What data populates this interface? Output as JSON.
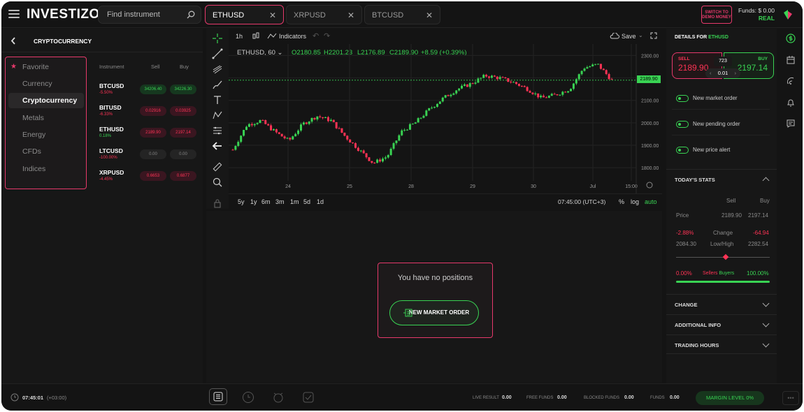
{
  "header": {
    "logo_text": "INVESTIZO",
    "search_placeholder": "Find instrument",
    "tabs": [
      {
        "label": "ETHUSD",
        "active": true
      },
      {
        "label": "XRPUSD",
        "active": false
      },
      {
        "label": "BTCUSD",
        "active": false
      }
    ],
    "switch_label_1": "SWITCH TO",
    "switch_label_2": "DEMO MONEY",
    "funds_label": "Funds: $ 0.00",
    "account_type": "REAL"
  },
  "sidebar": {
    "title": "CRYPTOCURRENCY",
    "categories": [
      "Favorite",
      "Currency",
      "Cryptocurrency",
      "Metals",
      "Energy",
      "CFDs",
      "Indices"
    ],
    "selected": "Cryptocurrency",
    "columns": {
      "instrument": "Instrument",
      "sell": "Sell",
      "buy": "Buy"
    },
    "instruments": [
      {
        "name": "BTCUSD",
        "change": "-5.50%",
        "sell": "34206.40",
        "buy": "34226.30",
        "trend": "up"
      },
      {
        "name": "BITUSD",
        "change": "-6.33%",
        "sell": "0.02916",
        "buy": "0.03925",
        "trend": "down"
      },
      {
        "name": "ETHUSD",
        "change": "0.18%",
        "sell": "2189.90",
        "buy": "2197.14",
        "trend": "down"
      },
      {
        "name": "LTCUSD",
        "change": "-100.00%",
        "sell": "0.00",
        "buy": "0.00",
        "trend": "none"
      },
      {
        "name": "XRPUSD",
        "change": "-4.45%",
        "sell": "0.6653",
        "buy": "0.6877",
        "trend": "down"
      }
    ]
  },
  "chart": {
    "interval": "1h",
    "indicators_label": "Indicators",
    "save_label": "Save",
    "symbol": "ETHUSD, 60",
    "ohlc": {
      "o": "O2180.85",
      "h": "H2201.23",
      "l": "L2176.89",
      "c": "C2189.90",
      "chg": "+8.59 (+0.39%)"
    },
    "price_tag": "2189.90",
    "y_ticks": [
      "2300.00",
      "2200.00",
      "2100.00",
      "2000.00",
      "1900.00",
      "1800.00"
    ],
    "x_ticks": [
      "24",
      "25",
      "28",
      "29",
      "30",
      "Jul",
      "15:00"
    ],
    "ranges": [
      "5y",
      "1y",
      "6m",
      "3m",
      "1m",
      "5d",
      "1d"
    ],
    "time": "07:45:00 (UTC+3)",
    "scale_opts": [
      "%",
      "log",
      "auto"
    ]
  },
  "chart_data": {
    "type": "line",
    "title": "ETHUSD, 60",
    "xlabel": "",
    "ylabel": "",
    "ylim": [
      1760,
      2320
    ],
    "x": [
      "24",
      "25",
      "28",
      "29",
      "30",
      "Jul"
    ],
    "series": [
      {
        "values": [
          1880,
          1990,
          2010,
          1960,
          1920,
          1995,
          2030,
          2010,
          1940,
          1880,
          1820,
          1850,
          1960,
          2000,
          2060,
          2110,
          2150,
          2175,
          2210,
          2200,
          2180,
          2150,
          2110,
          2125,
          2150,
          2245,
          2260,
          2190
        ]
      }
    ]
  },
  "positions": {
    "empty_text": "You have no positions",
    "new_order_label": "NEW MARKET ORDER"
  },
  "details": {
    "title": "DETAILS FOR",
    "symbol": "ETHUSD",
    "sell_label": "SELL",
    "sell_value": "2189.90",
    "buy_label": "BUY",
    "buy_value": "2197.14",
    "spread": "723",
    "lot": "0.01",
    "orders": [
      "New market order",
      "New pending order",
      "New price alert"
    ],
    "stats_title": "TODAY'S STATS",
    "stats_cols": {
      "sell": "Sell",
      "buy": "Buy"
    },
    "price_label": "Price",
    "price_sell": "2189.90",
    "price_buy": "2197.14",
    "change_pct": "-2.88%",
    "change_label": "Change",
    "change_val": "-64.94",
    "low": "2084.30",
    "lowhigh_label": "Low/High",
    "high": "2282.54",
    "sellers_pct": "0.00%",
    "sellers_label": "Sellers",
    "buyers_label": "Buyers",
    "buyers_pct": "100.00%",
    "sections": [
      "CHANGE",
      "ADDITIONAL INFO",
      "TRADING HOURS"
    ]
  },
  "footer": {
    "clock": "07:45:01",
    "tz": "(+03:00)",
    "live_result_label": "LIVE RESULT",
    "live_result": "0.00",
    "free_funds_label": "FREE FUNDS",
    "free_funds": "0.00",
    "blocked_funds_label": "BLOCKED FUNDS",
    "blocked_funds": "0.00",
    "funds_label": "FUNDS",
    "funds": "0.00",
    "margin_label": "MARGIN LEVEL 0%"
  },
  "colors": {
    "accent_green": "#39d353",
    "accent_red": "#ff3355",
    "border_pink": "#e6396b"
  }
}
